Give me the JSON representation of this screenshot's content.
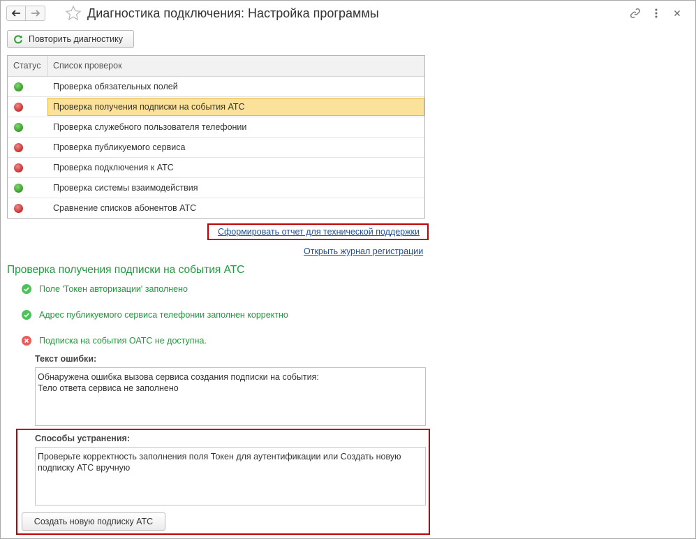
{
  "window": {
    "title": "Диагностика подключения: Настройка программы"
  },
  "toolbar": {
    "repeat_button": "Повторить диагностику"
  },
  "table": {
    "columns": [
      "Статус",
      "Список проверок"
    ],
    "rows": [
      {
        "status": "ok",
        "label": "Проверка обязательных полей"
      },
      {
        "status": "error",
        "label": "Проверка получения подписки на события АТС",
        "selected": true
      },
      {
        "status": "ok",
        "label": "Проверка служебного пользователя телефонии"
      },
      {
        "status": "error",
        "label": "Проверка публикуемого сервиса"
      },
      {
        "status": "error",
        "label": "Проверка подключения к АТС"
      },
      {
        "status": "ok",
        "label": "Проверка системы взаимодействия"
      },
      {
        "status": "error",
        "label": "Сравнение списков абонентов АТС"
      }
    ]
  },
  "links": {
    "report": "Сформировать отчет для технической поддержки",
    "journal": "Открыть журнал регистрации"
  },
  "details": {
    "title": "Проверка получения подписки на события АТС",
    "checks": [
      {
        "status": "ok",
        "text": "Поле 'Токен авторизации' заполнено"
      },
      {
        "status": "ok",
        "text": "Адрес публикуемого сервиса телефонии заполнен корректно"
      },
      {
        "status": "error",
        "text": "Подписка на события ОАТС не доступна."
      }
    ],
    "error_label": "Текст ошибки:",
    "error_text": "Обнаружена ошибка вызова сервиса создания подписки на события:\nТело ответа сервиса не заполнено",
    "fix_label": "Способы устранения:",
    "fix_text": "Проверьте корректность заполнения поля Токен для аутентификации или Создать новую\nподписку АТС вручную",
    "create_button": "Создать новую подписку АТС"
  },
  "colors": {
    "ok": "#3a9b2a",
    "error": "#c23131",
    "highlight_frame": "#c00000",
    "section_green": "#1e9b3a",
    "link": "#1f4e9a"
  }
}
